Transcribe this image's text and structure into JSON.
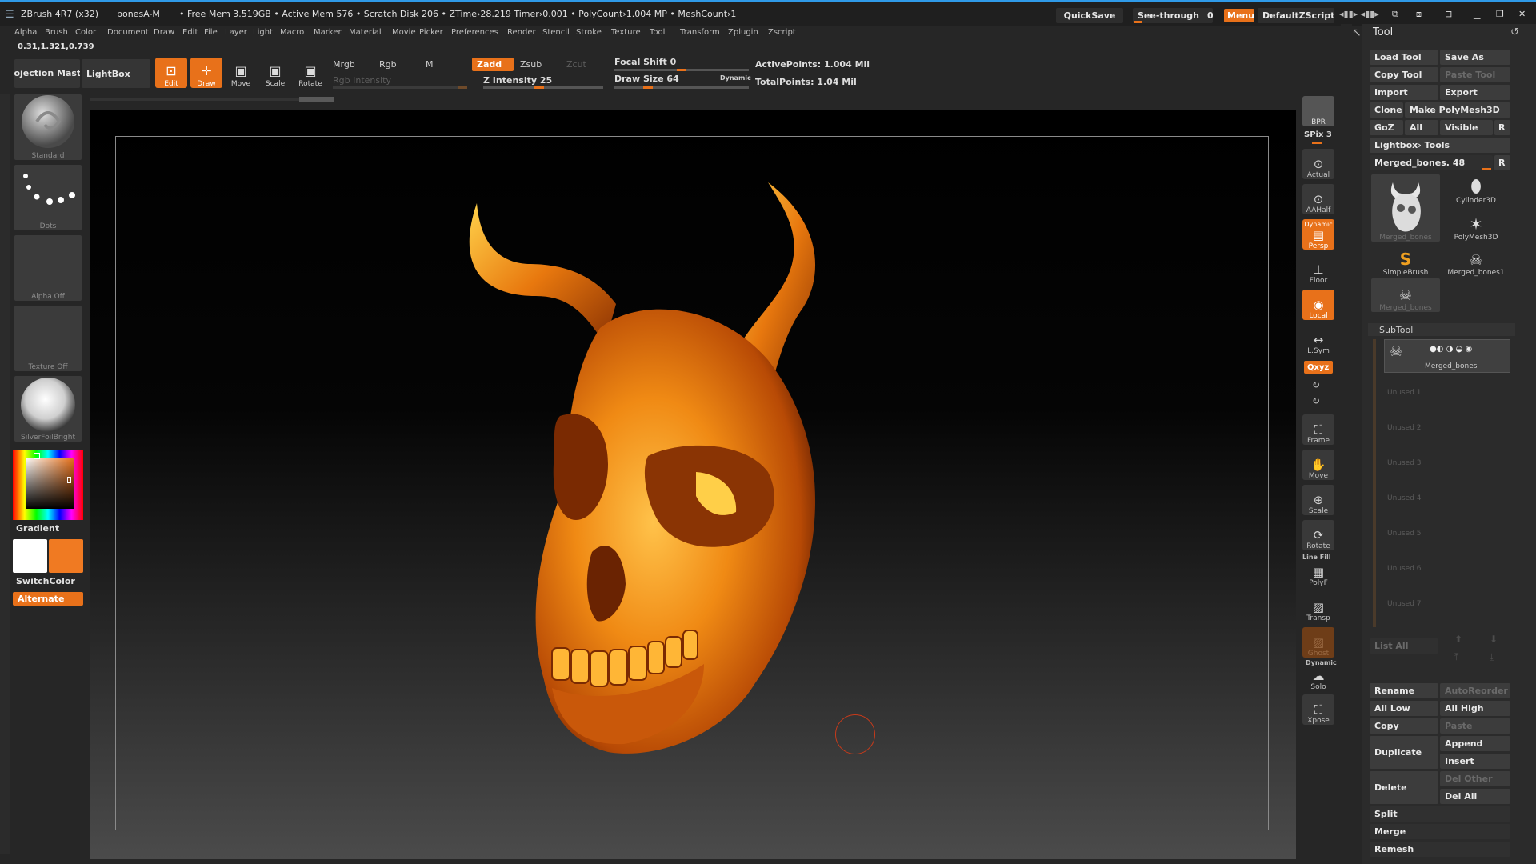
{
  "titlebar": {
    "app": "ZBrush 4R7 (x32)",
    "doc": "bonesA-M",
    "stats": "• Free Mem 3.519GB • Active Mem 576 • Scratch Disk 206 •  ZTime›28.219 Timer›0.001 • PolyCount›1.004 MP  • MeshCount›1",
    "quicksave": "QuickSave",
    "see_through": "See-through",
    "see_through_value": "0",
    "menus": "Menus",
    "script": "DefaultZScript"
  },
  "menu": [
    "Alpha",
    "Brush",
    "Color",
    "Document",
    "Draw",
    "Edit",
    "File",
    "Layer",
    "Light",
    "Macro",
    "Marker",
    "Material",
    "Movie",
    "Picker",
    "Preferences",
    "Render",
    "Stencil",
    "Stroke",
    "Texture",
    "Tool",
    "Transform",
    "Zplugin",
    "Zscript"
  ],
  "coords": "0.31,1.321,0.739",
  "toolbar": {
    "projection_master": "Projection Master",
    "lightbox": "LightBox",
    "edit": "Edit",
    "draw": "Draw",
    "move": "Move",
    "scale": "Scale",
    "rotate": "Rotate",
    "mrgb": "Mrgb",
    "rgb": "Rgb",
    "m": "M",
    "rgb_intensity": "Rgb Intensity",
    "zadd": "Zadd",
    "zsub": "Zsub",
    "zcut": "Zcut",
    "z_intensity": "Z Intensity 25",
    "focal_shift": "Focal Shift 0",
    "draw_size": "Draw Size 64",
    "dynamic": "Dynamic",
    "active_points": "ActivePoints: 1.004  Mil",
    "total_points": "TotalPoints: 1.04  Mil"
  },
  "left_shelf": {
    "brush": "Standard",
    "stroke": "Dots",
    "alpha": "Alpha  Off",
    "texture": "Texture  Off",
    "material": "SilverFoilBright",
    "gradient": "Gradient",
    "switch_color": "SwitchColor",
    "alternate": "Alternate"
  },
  "right_shelf": {
    "bpr": "BPR",
    "spix": "SPix 3",
    "actual": "Actual",
    "aahalf": "AAHalf",
    "dynamic": "Dynamic",
    "persp": "Persp",
    "floor": "Floor",
    "local": "Local",
    "lsym": "L.Sym",
    "xyz": "Qxyz",
    "frame": "Frame",
    "move": "Move",
    "scale": "Scale",
    "rotate": "Rotate",
    "line_fill": "Line Fill",
    "polyf": "PolyF",
    "transp": "Transp",
    "ghost": "Ghost",
    "dynamic2": "Dynamic",
    "solo": "Solo",
    "xpose": "Xpose"
  },
  "palette": {
    "title": "Tool",
    "load_tool": "Load Tool",
    "save_as": "Save As",
    "copy_tool": "Copy Tool",
    "paste_tool": "Paste Tool",
    "import": "Import",
    "export": "Export",
    "clone": "Clone",
    "make_polymesh": "Make PolyMesh3D",
    "goz": "GoZ",
    "all": "All",
    "visible": "Visible",
    "r": "R",
    "lightbox_tools": "Lightbox› Tools",
    "current_tool": "Merged_bones. 48",
    "r2": "R",
    "thumbs": [
      "Merged_bones",
      "Cylinder3D",
      "PolyMesh3D",
      "SimpleBrush",
      "Merged_bones1",
      "Merged_bones"
    ],
    "subtool": "SubTool",
    "subtool_item": "Merged_bones",
    "unused": [
      "Unused 1",
      "Unused 2",
      "Unused 3",
      "Unused 4",
      "Unused 5",
      "Unused 6",
      "Unused 7"
    ],
    "list_all": "List All",
    "rename": "Rename",
    "autoreorder": "AutoReorder",
    "all_low": "All Low",
    "all_high": "All High",
    "copy": "Copy",
    "paste": "Paste",
    "duplicate": "Duplicate",
    "append": "Append",
    "insert": "Insert",
    "delete": "Delete",
    "del_other": "Del Other",
    "del_all": "Del All",
    "split": "Split",
    "merge": "Merge",
    "remesh": "Remesh"
  },
  "colors": {
    "accent": "#e8711a",
    "primary_color": "#ffffff",
    "secondary_color": "#f07a22",
    "model": "#f08010"
  }
}
